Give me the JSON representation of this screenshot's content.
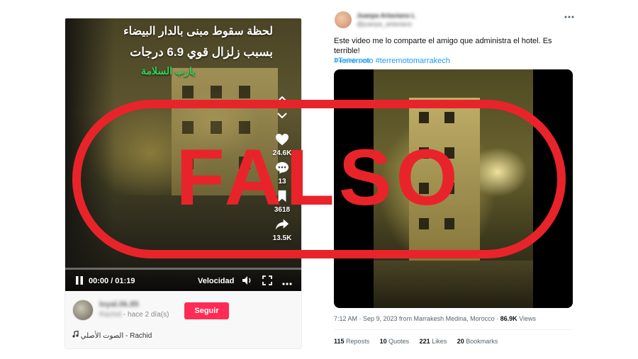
{
  "tiktok": {
    "caption_line1": "لحظة سقوط مبنى بالدار البيضاء",
    "caption_line2": "بسبب زلزال قوي 6.9 درجات",
    "caption_line3": "يارب السلامة",
    "likes": "24.6K",
    "comments": "13",
    "saves": "3618",
    "shares": "13.5K",
    "time": "00:00 / 01:19",
    "speed_label": "Velocidad",
    "username": "loyal.0k.85",
    "user_blur": "Rachid",
    "posted": "- hace 2 día(s)",
    "follow_label": "Seguir",
    "sound": "الصوت الأصلي - Rachid"
  },
  "tweet": {
    "author_name": "Juanpa Artaviano L",
    "author_handle": "@juanpa_artaviano",
    "text": "Este video me lo comparte el amigo que administra el hotel. Es terrible!",
    "hashtags": "#Terremoto #terremotomarrakech",
    "translate_label": "Translate post",
    "meta_prefix": "7:12 AM · Sep 9, 2023 from Marrakesh Medina, Morocco · ",
    "views_count": "86.9K",
    "views_label": "Views",
    "reposts_count": "115",
    "reposts_label": "Reposts",
    "quotes_count": "10",
    "quotes_label": "Quotes",
    "likes_count": "221",
    "likes_label": "Likes",
    "bookmarks_count": "20",
    "bookmarks_label": "Bookmarks"
  },
  "stamp": {
    "text": "FALSO",
    "color": "#e8242a"
  },
  "icons": {
    "more": "more-horizontal-icon",
    "heart": "heart-icon",
    "comment": "comment-icon",
    "bookmark": "bookmark-icon",
    "share": "share-icon",
    "pause": "pause-icon",
    "volume": "volume-icon",
    "fullscreen": "fullscreen-icon",
    "music": "music-note-icon"
  }
}
